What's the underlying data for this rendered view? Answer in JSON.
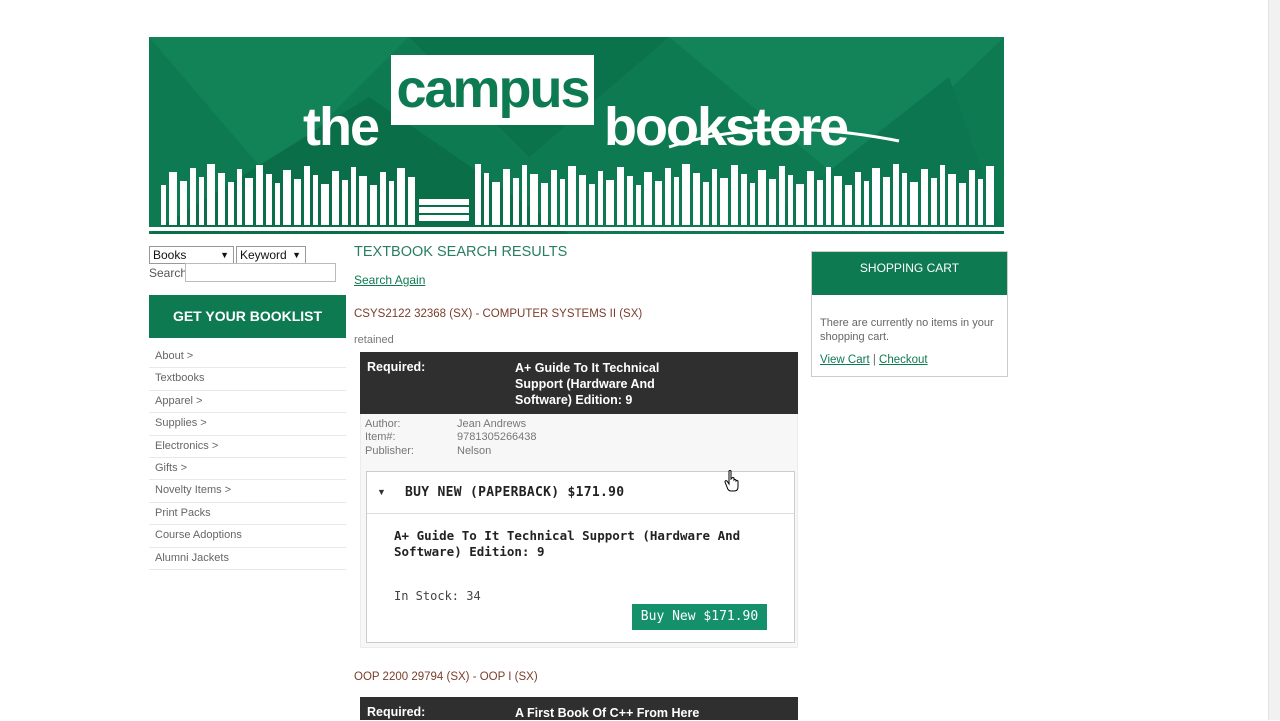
{
  "banner": {
    "word_the": "the",
    "word_campus": "campus",
    "word_bookstore": "bookstore"
  },
  "search": {
    "category_value": "Books",
    "type_value": "Keyword",
    "label": "Search",
    "input_value": ""
  },
  "sidebar": {
    "booklist_label": "GET YOUR BOOKLIST",
    "items": [
      {
        "label": "About >"
      },
      {
        "label": "Textbooks"
      },
      {
        "label": "Apparel >"
      },
      {
        "label": "Supplies >"
      },
      {
        "label": "Electronics >"
      },
      {
        "label": "Gifts >"
      },
      {
        "label": "Novelty Items >"
      },
      {
        "label": "Print Packs"
      },
      {
        "label": "Course Adoptions"
      },
      {
        "label": "Alumni Jackets"
      }
    ]
  },
  "main": {
    "title": "TEXTBOOK SEARCH RESULTS",
    "search_again": "Search Again",
    "courses": [
      {
        "course": "CSYS2122 32368 (SX) - COMPUTER SYSTEMS II (SX)",
        "note": "retained",
        "required_label": "Required:",
        "book_title": "A+ Guide To It Technical Support (Hardware And Software) Edition: 9",
        "author_label": "Author:",
        "author": "Jean Andrews",
        "item_label": "Item#:",
        "item": "9781305266438",
        "publisher_label": "Publisher:",
        "publisher": "Nelson",
        "option_header": "BUY NEW (PAPERBACK) $171.90",
        "option_title": "A+ Guide To It Technical Support (Hardware And Software) Edition: 9",
        "stock": "In Stock: 34",
        "buy_button": "Buy New $171.90"
      },
      {
        "course": "OOP 2200 29794 (SX) - OOP I (SX)",
        "required_label": "Required:",
        "book_title": "A First Book Of C++ From Here"
      }
    ]
  },
  "cart": {
    "title": "SHOPPING CART",
    "message": "There are currently no items in your shopping cart.",
    "view_cart": "View Cart",
    "separator": "|",
    "checkout": "Checkout"
  },
  "colors": {
    "brand_green": "#0e7a52",
    "dark_header": "#2f2f2f",
    "button_green": "#14906a"
  }
}
